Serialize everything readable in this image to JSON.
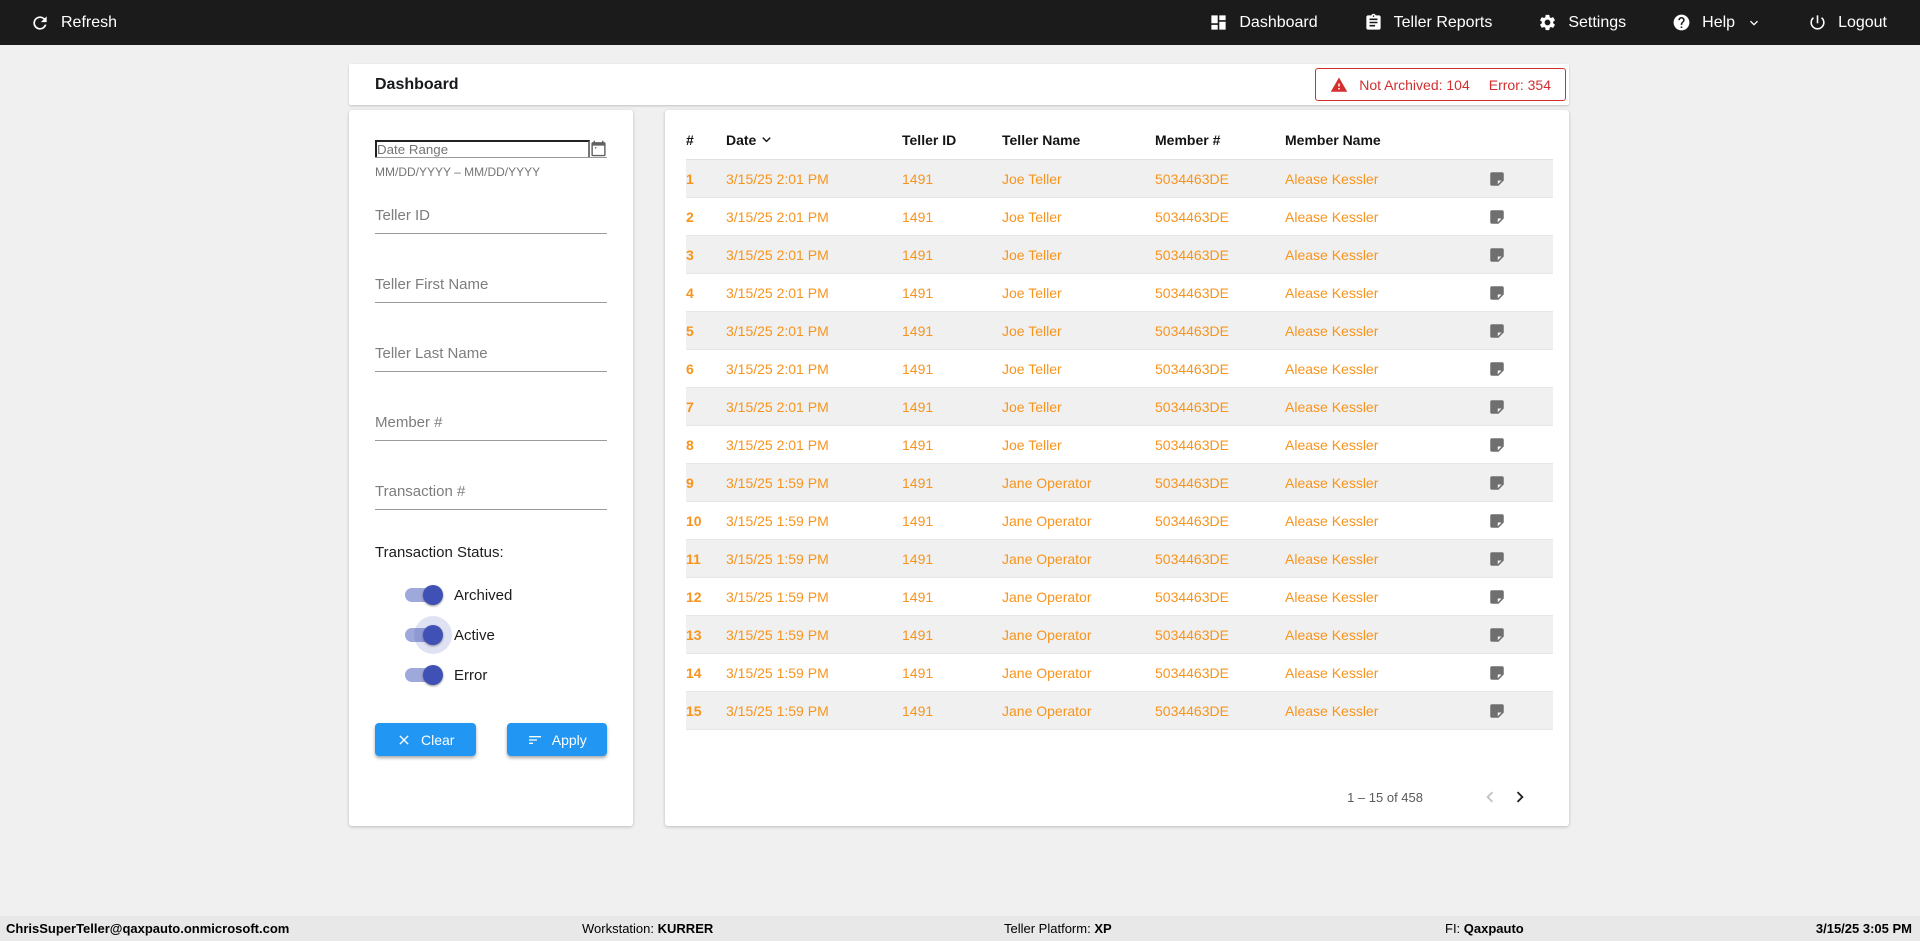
{
  "colors": {
    "topbar_bg": "#1b1b1b",
    "page_bg": "#f0f0f0",
    "accent_orange": "#f7941e",
    "button_blue": "#2196f3",
    "toggle_blue": "#3f51b5",
    "alert_red": "#d32f2f"
  },
  "topbar": {
    "refresh_label": "Refresh",
    "nav": [
      {
        "label": "Dashboard"
      },
      {
        "label": "Teller Reports"
      },
      {
        "label": "Settings"
      },
      {
        "label": "Help"
      },
      {
        "label": "Logout"
      }
    ]
  },
  "header": {
    "title": "Dashboard",
    "alert": {
      "not_archived": "Not Archived: 104",
      "error": "Error: 354"
    }
  },
  "filters": {
    "date_range": {
      "placeholder": "Date Range",
      "hint": "MM/DD/YYYY – MM/DD/YYYY"
    },
    "teller_id": {
      "placeholder": "Teller ID"
    },
    "teller_first_name": {
      "placeholder": "Teller First Name"
    },
    "teller_last_name": {
      "placeholder": "Teller Last Name"
    },
    "member_number": {
      "placeholder": "Member #"
    },
    "transaction_number": {
      "placeholder": "Transaction #"
    },
    "status_label": "Transaction Status:",
    "toggles": [
      {
        "label": "Archived",
        "on": true
      },
      {
        "label": "Active",
        "on": true
      },
      {
        "label": "Error",
        "on": true
      }
    ],
    "clear_label": "Clear",
    "apply_label": "Apply"
  },
  "table": {
    "columns": [
      "#",
      "Date",
      "Teller ID",
      "Teller Name",
      "Member #",
      "Member Name"
    ],
    "rows": [
      {
        "num": "1",
        "date": "3/15/25 2:01 PM",
        "teller_id": "1491",
        "teller_name": "Joe Teller",
        "member_number": "5034463DE",
        "member_name": "Alease Kessler"
      },
      {
        "num": "2",
        "date": "3/15/25 2:01 PM",
        "teller_id": "1491",
        "teller_name": "Joe Teller",
        "member_number": "5034463DE",
        "member_name": "Alease Kessler"
      },
      {
        "num": "3",
        "date": "3/15/25 2:01 PM",
        "teller_id": "1491",
        "teller_name": "Joe Teller",
        "member_number": "5034463DE",
        "member_name": "Alease Kessler"
      },
      {
        "num": "4",
        "date": "3/15/25 2:01 PM",
        "teller_id": "1491",
        "teller_name": "Joe Teller",
        "member_number": "5034463DE",
        "member_name": "Alease Kessler"
      },
      {
        "num": "5",
        "date": "3/15/25 2:01 PM",
        "teller_id": "1491",
        "teller_name": "Joe Teller",
        "member_number": "5034463DE",
        "member_name": "Alease Kessler"
      },
      {
        "num": "6",
        "date": "3/15/25 2:01 PM",
        "teller_id": "1491",
        "teller_name": "Joe Teller",
        "member_number": "5034463DE",
        "member_name": "Alease Kessler"
      },
      {
        "num": "7",
        "date": "3/15/25 2:01 PM",
        "teller_id": "1491",
        "teller_name": "Joe Teller",
        "member_number": "5034463DE",
        "member_name": "Alease Kessler"
      },
      {
        "num": "8",
        "date": "3/15/25 2:01 PM",
        "teller_id": "1491",
        "teller_name": "Joe Teller",
        "member_number": "5034463DE",
        "member_name": "Alease Kessler"
      },
      {
        "num": "9",
        "date": "3/15/25 1:59 PM",
        "teller_id": "1491",
        "teller_name": "Jane Operator",
        "member_number": "5034463DE",
        "member_name": "Alease Kessler"
      },
      {
        "num": "10",
        "date": "3/15/25 1:59 PM",
        "teller_id": "1491",
        "teller_name": "Jane Operator",
        "member_number": "5034463DE",
        "member_name": "Alease Kessler"
      },
      {
        "num": "11",
        "date": "3/15/25 1:59 PM",
        "teller_id": "1491",
        "teller_name": "Jane Operator",
        "member_number": "5034463DE",
        "member_name": "Alease Kessler"
      },
      {
        "num": "12",
        "date": "3/15/25 1:59 PM",
        "teller_id": "1491",
        "teller_name": "Jane Operator",
        "member_number": "5034463DE",
        "member_name": "Alease Kessler"
      },
      {
        "num": "13",
        "date": "3/15/25 1:59 PM",
        "teller_id": "1491",
        "teller_name": "Jane Operator",
        "member_number": "5034463DE",
        "member_name": "Alease Kessler"
      },
      {
        "num": "14",
        "date": "3/15/25 1:59 PM",
        "teller_id": "1491",
        "teller_name": "Jane Operator",
        "member_number": "5034463DE",
        "member_name": "Alease Kessler"
      },
      {
        "num": "15",
        "date": "3/15/25 1:59 PM",
        "teller_id": "1491",
        "teller_name": "Jane Operator",
        "member_number": "5034463DE",
        "member_name": "Alease Kessler"
      }
    ],
    "pagination": "1 – 15 of 458"
  },
  "footer": {
    "user": "ChrisSuperTeller@qaxpauto.onmicrosoft.com",
    "workstation_label": "Workstation:",
    "workstation": "KURRER",
    "platform_label": "Teller Platform:",
    "platform": "XP",
    "fi_label": "FI:",
    "fi": "Qaxpauto",
    "datetime": "3/15/25 3:05 PM"
  }
}
